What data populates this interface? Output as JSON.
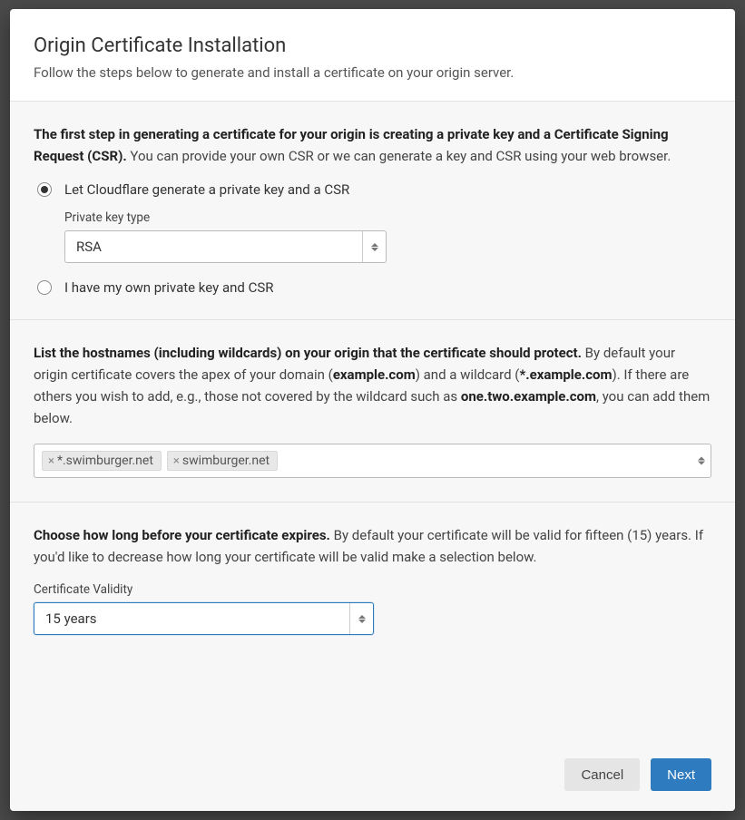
{
  "header": {
    "title": "Origin Certificate Installation",
    "subtitle": "Follow the steps below to generate and install a certificate on your origin server."
  },
  "step1": {
    "intro_bold": "The first step in generating a certificate for your origin is creating a private key and a Certificate Signing Request (CSR).",
    "intro_rest": " You can provide your own CSR or we can generate a key and CSR using your web browser.",
    "option_generate": "Let Cloudflare generate a private key and a CSR",
    "key_type_label": "Private key type",
    "key_type_value": "RSA",
    "option_own": "I have my own private key and CSR"
  },
  "step2": {
    "intro_bold": "List the hostnames (including wildcards) on your origin that the certificate should protect.",
    "intro_mid1": " By default your origin certificate covers the apex of your domain (",
    "example_apex": "example.com",
    "intro_mid2": ") and a wildcard (",
    "example_wild": "*.example.com",
    "intro_mid3": "). If there are others you wish to add, e.g., those not covered by the wildcard such as ",
    "example_sub": "one.two.example.com",
    "intro_end": ", you can add them below.",
    "tags": [
      "*.swimburger.net",
      "swimburger.net"
    ]
  },
  "step3": {
    "intro_bold": "Choose how long before your certificate expires.",
    "intro_rest": " By default your certificate will be valid for fifteen (15) years. If you'd like to decrease how long your certificate will be valid make a selection below.",
    "validity_label": "Certificate Validity",
    "validity_value": "15 years"
  },
  "footer": {
    "cancel": "Cancel",
    "next": "Next"
  }
}
